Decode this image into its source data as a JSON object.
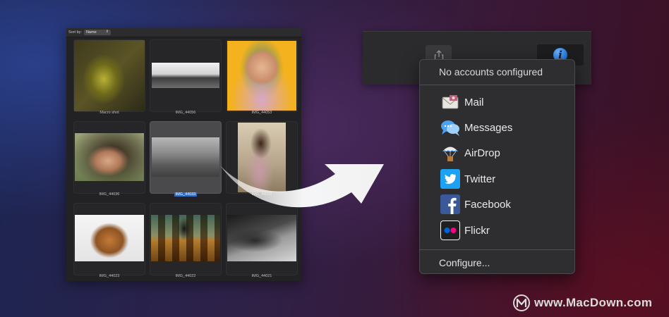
{
  "browser": {
    "sort_label": "Sort by:",
    "sort_value": "Name",
    "items": [
      {
        "name": "Macro shot",
        "selected": false
      },
      {
        "name": "IMG_44056",
        "selected": false
      },
      {
        "name": "IMG_44053",
        "selected": false
      },
      {
        "name": "IMG_44036",
        "selected": false
      },
      {
        "name": "IMG_44033",
        "selected": true
      },
      {
        "name": "IMG_44032",
        "selected": false
      },
      {
        "name": "IMG_44023",
        "selected": false
      },
      {
        "name": "IMG_44022",
        "selected": false
      },
      {
        "name": "IMG_44021",
        "selected": false
      }
    ]
  },
  "share_menu": {
    "header": "No accounts configured",
    "items": [
      {
        "label": "Mail",
        "icon": "mail-icon"
      },
      {
        "label": "Messages",
        "icon": "messages-icon"
      },
      {
        "label": "AirDrop",
        "icon": "airdrop-icon"
      },
      {
        "label": "Twitter",
        "icon": "twitter-icon"
      },
      {
        "label": "Facebook",
        "icon": "facebook-icon"
      },
      {
        "label": "Flickr",
        "icon": "flickr-icon"
      }
    ],
    "footer": "Configure..."
  },
  "toolbar": {
    "share_icon": "share-icon",
    "info_icon": "info-icon",
    "info_glyph": "i"
  },
  "watermark": {
    "logo_letter": "M",
    "text": "www.MacDown.com"
  },
  "colors": {
    "accent": "#2d6fd1",
    "info_blue": "#1d74d8",
    "twitter": "#1da1f2",
    "facebook": "#3b5998",
    "flickr_pink": "#ff0084",
    "flickr_blue": "#0063dc"
  }
}
